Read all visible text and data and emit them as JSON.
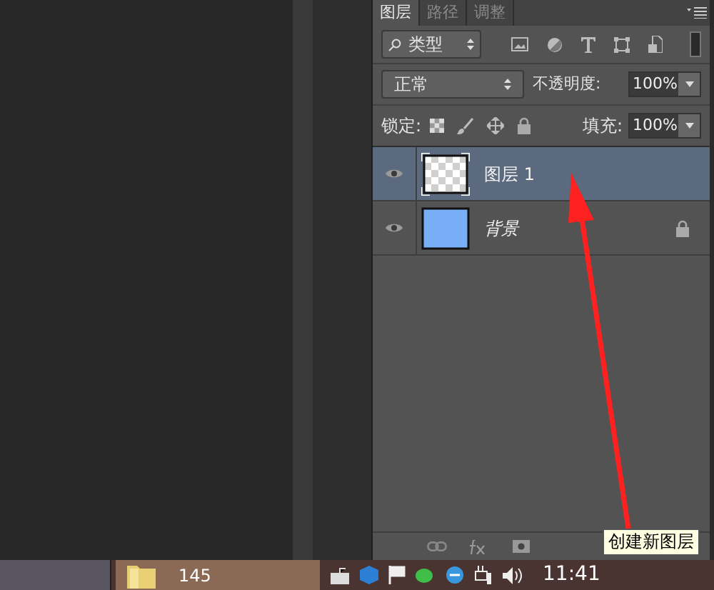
{
  "panel": {
    "tabs": [
      {
        "label": "图层",
        "selected": true
      },
      {
        "label": "路径",
        "selected": false
      },
      {
        "label": "调整",
        "selected": false
      }
    ],
    "filter": {
      "value": "类型"
    },
    "blend_mode": {
      "value": "正常"
    },
    "opacity": {
      "label": "不透明度:",
      "value": "100%"
    },
    "lock": {
      "label": "锁定:"
    },
    "fill": {
      "label": "填充:",
      "value": "100%"
    },
    "layers": [
      {
        "name": "图层 1",
        "selected": true,
        "visible": true,
        "locked": false,
        "kind": "transparent"
      },
      {
        "name": "背景",
        "selected": false,
        "visible": true,
        "locked": true,
        "kind": "solid",
        "color": "#78aef5"
      }
    ],
    "tooltip": "创建新图层"
  },
  "taskbar": {
    "items": [
      {
        "label": "145"
      }
    ],
    "clock": "11:41"
  }
}
